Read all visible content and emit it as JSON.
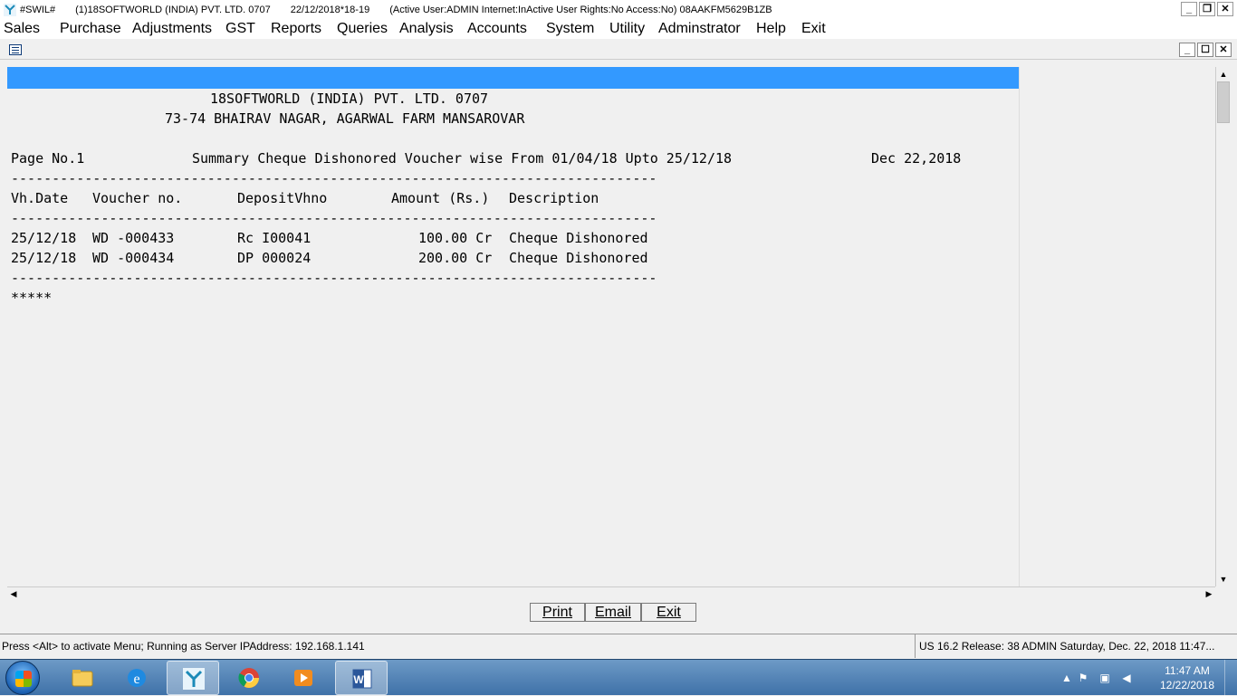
{
  "titlebar": {
    "app_name": "#SWIL#",
    "company": "(1)18SOFTWORLD (INDIA) PVT. LTD. 0707",
    "session": "22/12/2018*18-19",
    "status": "(Active User:ADMIN Internet:InActive User Rights:No Access:No) 08AAKFM5629B1ZB",
    "buttons": {
      "minimize": "_",
      "restore": "❐",
      "close": "✕"
    }
  },
  "menu": [
    "Sales",
    "Purchase",
    "Adjustments",
    "GST",
    "Reports",
    "Queries",
    "Analysis",
    "Accounts",
    "System",
    "Utility",
    "Adminstrator",
    "Help",
    "Exit"
  ],
  "child_window": {
    "buttons": {
      "minimize": "_",
      "restore": "☐",
      "close": "✕"
    }
  },
  "report": {
    "company": "18SOFTWORLD (INDIA) PVT. LTD. 0707",
    "address": "73-74 BHAIRAV NAGAR, AGARWAL FARM MANSAROVAR",
    "page_no": "Page No.1",
    "title": "Summary Cheque Dishonored Voucher wise From 01/04/18 Upto 25/12/18",
    "date": "Dec 22,2018",
    "separator": "-------------------------------------------------------------------------------",
    "columns": [
      "Vh.Date",
      "Voucher no.",
      "DepositVhno",
      "Amount (Rs.)",
      "Description"
    ],
    "rows": [
      {
        "date": "25/12/18",
        "voucher": "WD -000433",
        "deposit": "Rc I00041",
        "amount": "100.00 Cr",
        "description": "Cheque Dishonored"
      },
      {
        "date": "25/12/18",
        "voucher": "WD -000434",
        "deposit": "DP 000024",
        "amount": "200.00 Cr",
        "description": "Cheque Dishonored"
      }
    ],
    "footer": "*****"
  },
  "buttons": {
    "print": "Print",
    "email": "Email",
    "exit": "Exit"
  },
  "statusbar": {
    "left": "Press <Alt> to activate Menu; Running as Server IPAddress: 192.168.1.141",
    "right": "US 16.2 Release: 38  ADMIN  Saturday, Dec. 22, 2018  11:47..."
  },
  "taskbar": {
    "apps": [
      "start-menu",
      "file-explorer",
      "internet-explorer",
      "swil-app",
      "chrome",
      "media-player",
      "word"
    ],
    "clock_time": "11:47 AM",
    "clock_date": "12/22/2018"
  },
  "colors": {
    "header_band": "#3399ff",
    "taskbar": "#3f71a8"
  }
}
